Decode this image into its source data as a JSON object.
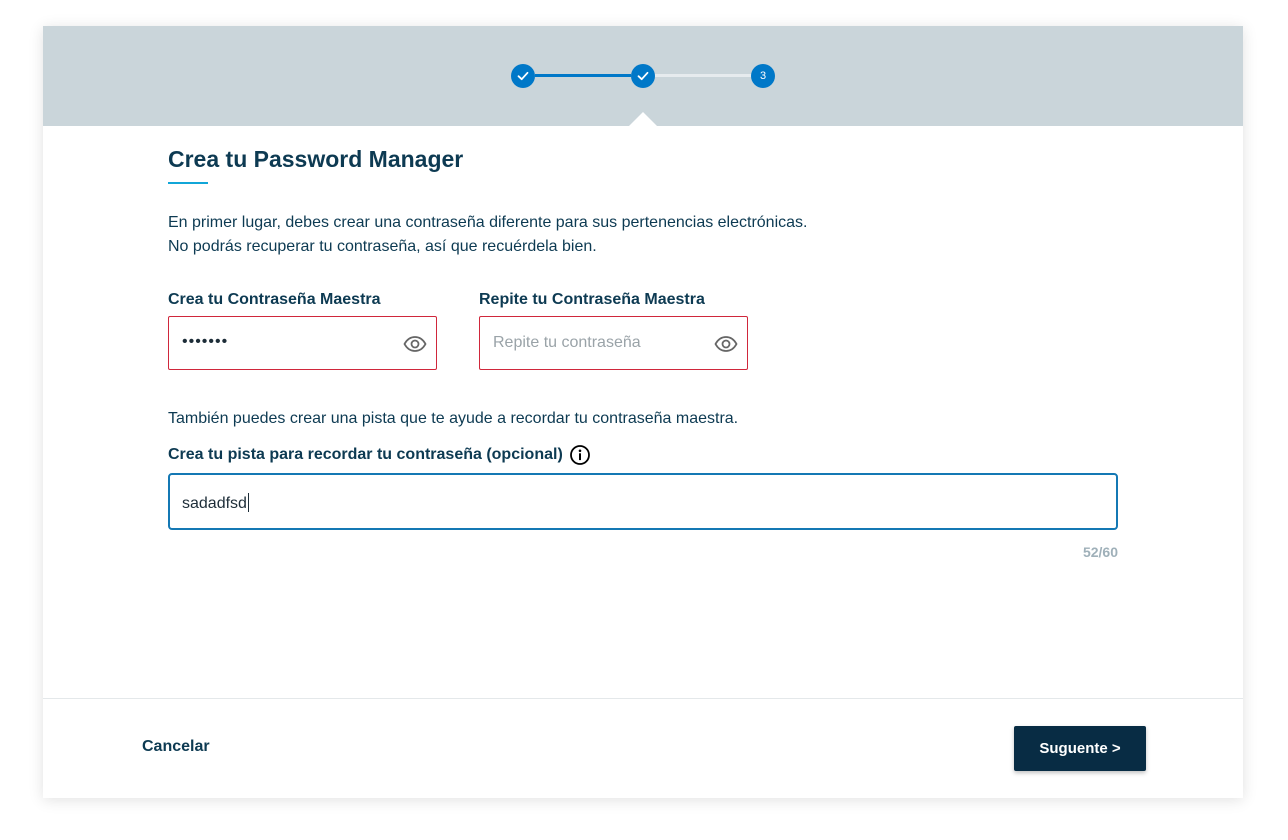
{
  "stepper": {
    "steps": [
      {
        "state": "completed",
        "icon": "check-icon"
      },
      {
        "state": "completed",
        "icon": "check-icon"
      },
      {
        "state": "current",
        "number": "3"
      }
    ],
    "colors": {
      "active": "#0078c8",
      "inactive_line": "#e6ebee",
      "bar_bg": "#cad5da"
    }
  },
  "page": {
    "title": "Crea tu Password Manager",
    "intro_line1": "En primer lugar, debes crear una contraseña diferente para sus pertenencias electrónicas.",
    "intro_line2": "No podrás recuperar tu contraseña, así que recuérdela bien."
  },
  "password": {
    "label": "Crea tu Contraseña Maestra",
    "value_masked": "•••••••",
    "toggle_icon": "eye-icon"
  },
  "repeat_password": {
    "label": "Repite tu Contraseña Maestra",
    "placeholder": "Repite tu contraseña",
    "value": "",
    "toggle_icon": "eye-icon"
  },
  "hint": {
    "intro": "También puedes crear una pista que te ayude a recordar tu contraseña maestra.",
    "label": "Crea tu pista para recordar tu contraseña (opcional)",
    "info_icon": "info-icon",
    "value": "sadadfsd",
    "counter": "52/60"
  },
  "footer": {
    "cancel_label": "Cancelar",
    "next_label": "Suguente >"
  },
  "colors": {
    "error_border": "#d0273b",
    "focus_border": "#1478b4",
    "primary_button": "#082c44",
    "text": "#0d3a52",
    "accent_underline": "#11a6d8"
  }
}
